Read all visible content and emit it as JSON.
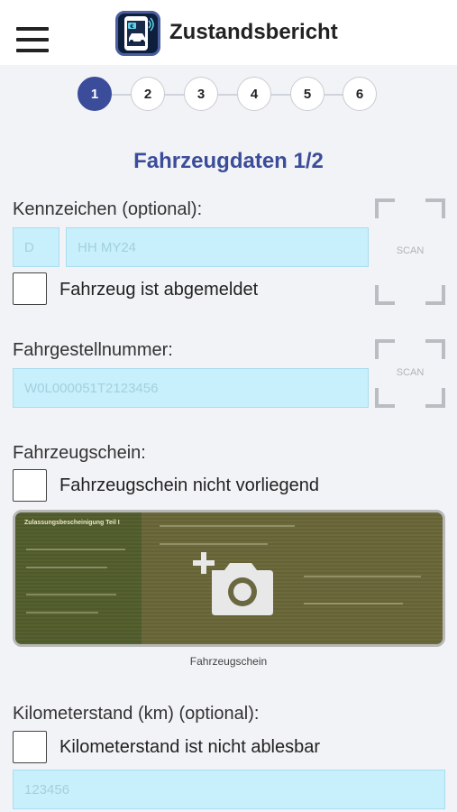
{
  "header": {
    "title": "Zustandsbericht",
    "menu_icon": "hamburger-icon",
    "app_icon": "car-report-app-icon"
  },
  "stepper": {
    "steps": [
      "1",
      "2",
      "3",
      "4",
      "5",
      "6"
    ],
    "active_step": 1
  },
  "section": {
    "title": "Fahrzeugdaten 1/2"
  },
  "license_plate": {
    "label": "Kennzeichen (optional):",
    "country_placeholder": "D",
    "number_placeholder": "HH MY24",
    "deregistered_label": "Fahrzeug ist abgemeldet",
    "scan_label": "SCAN"
  },
  "vin": {
    "label": "Fahrgestellnummer:",
    "placeholder": "W0L000051T2123456",
    "scan_label": "SCAN"
  },
  "registration_doc": {
    "label": "Fahrzeugschein:",
    "not_present_label": "Fahrzeugschein nicht vorliegend",
    "photo_caption": "Fahrzeugschein",
    "photo_header": "Zulassungsbescheinigung Teil I",
    "add_photo_icon": "add-photo-camera-icon"
  },
  "mileage": {
    "label": "Kilometerstand (km) (optional):",
    "not_readable_label": "Kilometerstand ist nicht ablesbar",
    "placeholder": "123456"
  },
  "colors": {
    "accent": "#3b4d9a",
    "input_bg": "#c8f0fc",
    "page_bg": "#f2f3f6"
  }
}
